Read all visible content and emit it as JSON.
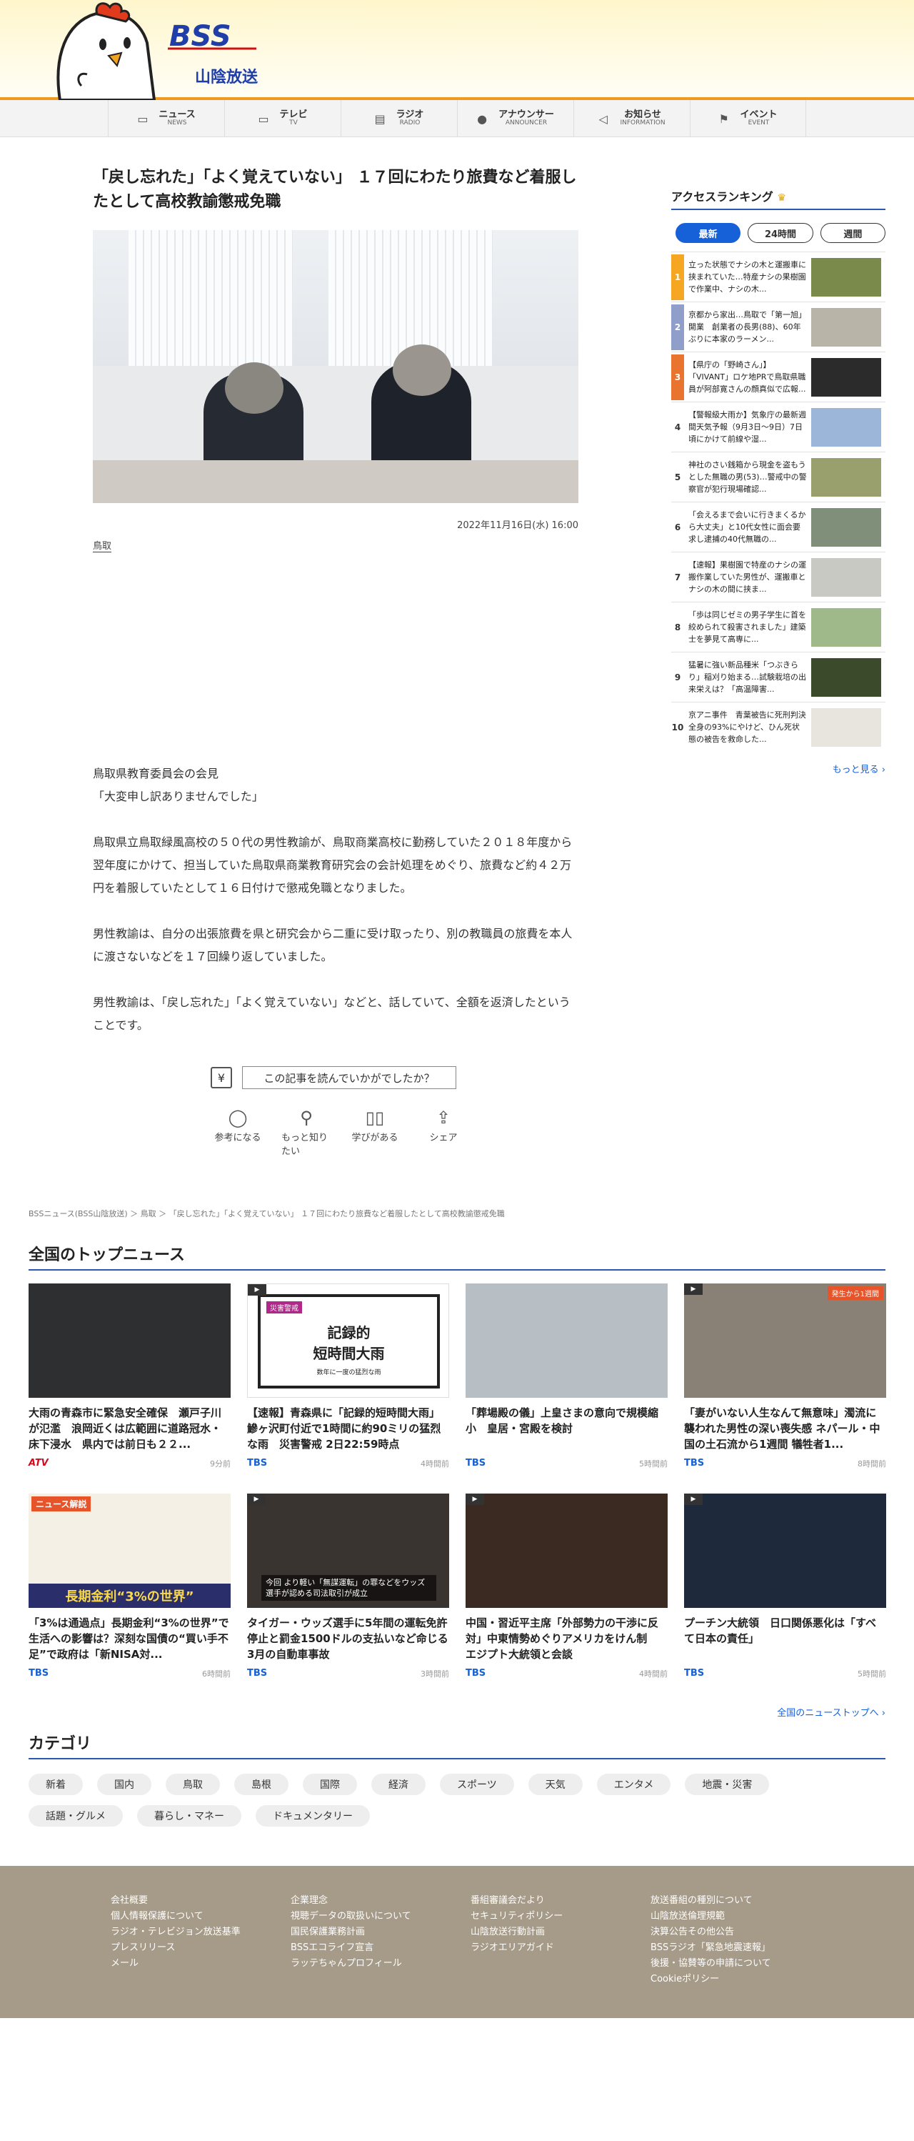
{
  "header": {
    "logo_text": "BSS",
    "station_name": "山陰放送"
  },
  "nav": [
    {
      "ja": "ニュース",
      "en": "NEWS",
      "icon": "tv-monitor-icon"
    },
    {
      "ja": "テレビ",
      "en": "TV",
      "icon": "tv-icon"
    },
    {
      "ja": "ラジオ",
      "en": "RADIO",
      "icon": "radio-icon"
    },
    {
      "ja": "アナウンサー",
      "en": "ANNOUNCER",
      "icon": "microphone-icon"
    },
    {
      "ja": "お知らせ",
      "en": "INFORMATION",
      "icon": "megaphone-icon"
    },
    {
      "ja": "イベント",
      "en": "EVENT",
      "icon": "flag-icon"
    }
  ],
  "article": {
    "title": "「戻し忘れた」「よく覚えていない」 １７回にわたり旅費など着服したとして高校教諭懲戒免職",
    "date": "2022年11月16日(水) 16:00",
    "tag": "鳥取",
    "paragraphs": [
      "鳥取県教育委員会の会見",
      "「大変申し訳ありませんでした」",
      "鳥取県立鳥取緑風高校の５０代の男性教諭が、鳥取商業高校に勤務していた２０１８年度から翌年度にかけて、担当していた鳥取県商業教育研究会の会計処理をめぐり、旅費など約４２万円を着服していたとして１６日付けで懲戒免職となりました。",
      "男性教諭は、自分の出張旅費を県と研究会から二重に受け取ったり、別の教職員の旅費を本人に渡さないなどを１７回繰り返していました。",
      "男性教諭は、「戻し忘れた」「よく覚えていない」などと、話していて、全額を返済したということです。"
    ]
  },
  "feedback": {
    "question": "この記事を読んでいかがでしたか？",
    "buttons": [
      {
        "label": "参考になる",
        "icon": "lightbulb-icon"
      },
      {
        "label": "もっと知りたい",
        "icon": "magnifier-icon"
      },
      {
        "label": "学びがある",
        "icon": "book-icon"
      },
      {
        "label": "シェア",
        "icon": "share-icon"
      }
    ]
  },
  "ranking": {
    "title": "アクセスランキング",
    "tabs": [
      "最新",
      "24時間",
      "週間"
    ],
    "items": [
      {
        "num": "1",
        "text": "立った状態でナシの木と運搬車に挟まれていた…特産ナシの果樹園で作業中、ナシの木...",
        "color": "#f5a623"
      },
      {
        "num": "2",
        "text": "京都から家出…鳥取で「第一旭」開業　創業者の長男(88)、60年ぶりに本家のラーメン...",
        "color": "#8f9fc9"
      },
      {
        "num": "3",
        "text": "【県庁の「野崎さん」】「VIVANT」ロケ地PRで鳥取県職員が阿部寛さんの顔真似で広報...",
        "color": "#e8742f"
      },
      {
        "num": "4",
        "text": "【警報級大雨か】気象庁の最新週間天気予報（9月3日～9日）7日頃にかけて前線や湿...",
        "color": ""
      },
      {
        "num": "5",
        "text": "神社のさい銭箱から現金を盗もうとした無職の男(53)…警戒中の警察官が犯行現場確認...",
        "color": ""
      },
      {
        "num": "6",
        "text": "「会えるまで会いに行きまくるから大丈夫」と10代女性に面会要求し逮捕の40代無職の...",
        "color": ""
      },
      {
        "num": "7",
        "text": "【速報】果樹園で特産のナシの運搬作業していた男性が、運搬車とナシの木の間に挟ま...",
        "color": ""
      },
      {
        "num": "8",
        "text": "「歩は同じゼミの男子学生に首を絞められて殺害されました」建築士を夢見て高専に...",
        "color": ""
      },
      {
        "num": "9",
        "text": "猛暑に強い新品種米「つぶきらり」稲刈り始まる…試験栽培の出来栄えは？「高温障害...",
        "color": ""
      },
      {
        "num": "10",
        "text": "京アニ事件　青葉被告に死刑判決　全身の93%にやけど、ひん死状態の被告を救命した...",
        "color": ""
      }
    ],
    "more": "もっと見る"
  },
  "breadcrumb": "BSSニュース(BSS山陰放送) ＞ 鳥取 ＞ 「戻し忘れた」「よく覚えていない」 １７回にわたり旅費など着服したとして高校教諭懲戒免職",
  "top_news": {
    "title": "全国のトップニュース",
    "items": [
      {
        "title": "大雨の青森市に緊急安全確保　瀬戸子川が氾濫　浪岡近くは広範囲に道路冠水・床下浸水　県内では前日も２２...",
        "source": "ATV",
        "time": "9分前",
        "video": false
      },
      {
        "title": "【速報】青森県に「記録的短時間大雨」　鰺ヶ沢町付近で1時間に約90ミリの猛烈な雨　災害警戒 2日22:59時点",
        "source": "TBS",
        "time": "4時間前",
        "video": true,
        "img_label": "災害警戒",
        "img_title_1": "記録的",
        "img_title_2": "短時間大雨",
        "img_caption": "数年に一度の猛烈な雨"
      },
      {
        "title": "「葬場殿の儀」上皇さまの意向で規模縮小　皇居・宮殿を検討",
        "source": "TBS",
        "time": "5時間前",
        "video": false
      },
      {
        "title": "「妻がいない人生なんて無意味」濁流に襲われた男性の深い喪失感 ネパール・中国の土石流から1週間 犠牲者1...",
        "source": "TBS",
        "time": "8時間前",
        "video": true,
        "img_badge": "発生から1週間"
      },
      {
        "title": "「3%は通過点」長期金利“3%の世界”で生活への影響は？深刻な国債の“買い手不足”で政府は「新NISA対...",
        "source": "TBS",
        "time": "6時間前",
        "video": false,
        "img_badge": "ニュース解説",
        "img_banner": "長期金利“3%の世界”"
      },
      {
        "title": "タイガー・ウッズ選手に5年間の運転免許停止と罰金1500ドルの支払いなど命じる 3月の自動車事故",
        "source": "TBS",
        "time": "3時間前",
        "video": true,
        "img_caption": "今回 より軽い「無謀運転」の罪などをウッズ選手が認める司法取引が成立"
      },
      {
        "title": "中国・習近平主席「外部勢力の干渉に反対」中東情勢めぐりアメリカをけん制　エジプト大統領と会談",
        "source": "TBS",
        "time": "4時間前",
        "video": true
      },
      {
        "title": "プーチン大統領　日口関係悪化は「すべて日本の責任」",
        "source": "TBS",
        "time": "5時間前",
        "video": true
      }
    ],
    "link": "全国のニューストップへ"
  },
  "categories": {
    "title": "カテゴリ",
    "items": [
      "新着",
      "国内",
      "鳥取",
      "島根",
      "国際",
      "経済",
      "スポーツ",
      "天気",
      "エンタメ",
      "地震・災害",
      "話題・グルメ",
      "暮らし・マネー",
      "ドキュメンタリー"
    ]
  },
  "footer": {
    "columns": [
      [
        "会社概要",
        "個人情報保護について",
        "ラジオ・テレビジョン放送基準",
        "プレスリリース",
        "メール"
      ],
      [
        "企業理念",
        "視聴データの取扱いについて",
        "国民保護業務計画",
        "BSSエコライフ宣言",
        "ラッテちゃんプロフィール"
      ],
      [
        "番組審議会だより",
        "セキュリティポリシー",
        "山陰放送行動計画",
        "ラジオエリアガイド"
      ],
      [
        "放送番組の種別について",
        "山陰放送倫理規範",
        "決算公告その他公告",
        "BSSラジオ「緊急地震速報」",
        "後援・協賛等の申請について",
        "Cookieポリシー"
      ]
    ]
  },
  "colors": {
    "accent": "#2a59b3",
    "link": "#1660d8",
    "header_orange": "#f29a1f",
    "footer": "#a69a88"
  }
}
